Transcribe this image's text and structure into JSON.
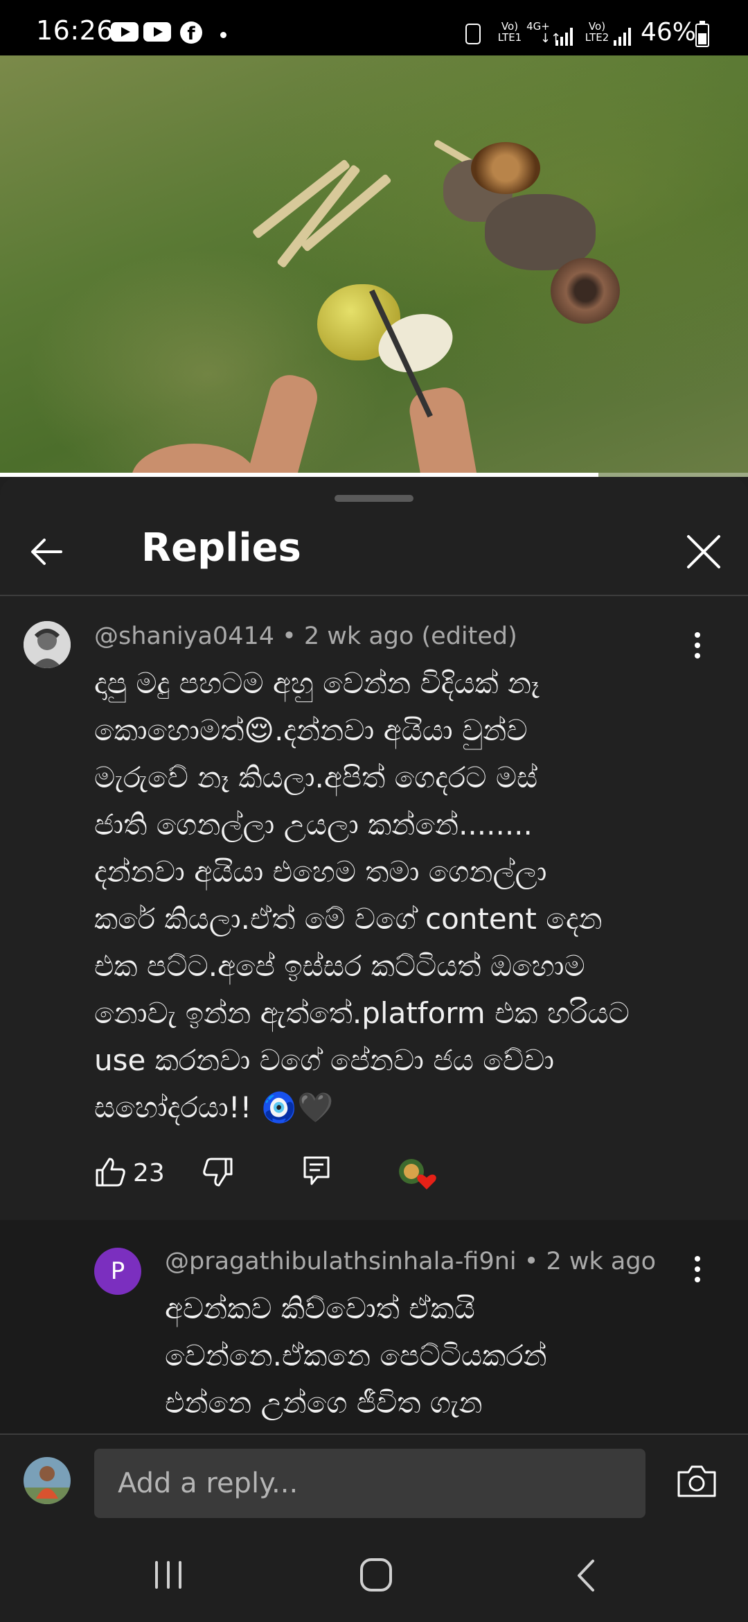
{
  "status_bar": {
    "time": "16:26",
    "sim1": "Vo)\nLTE1",
    "net": "4G+",
    "sim2": "Vo)\nLTE2",
    "battery": "46%"
  },
  "video": {
    "progress": 0.8
  },
  "header": {
    "title": "Replies"
  },
  "comment": {
    "meta": "@shaniya0414 • 2 wk ago (edited)",
    "text": "දාපු මදු පහටම අහු වෙන්න විදියක් නෑ\nකොහොමත්😌.දන්නවා අයියා වුන්ව\nමැරුවේ නෑ කියලා.අපිත් ගෙදරට මස්\nජාති ගෙනල්ලා උයලා කන්නේ........\nදන්නවා අයියා එහෙම තමා ගෙනල්ලා\nකරේ කියලා.ඒත් මේ වගේ content  දෙන\nඑක පට්ට.අපේ ඉස්සර කට්ටියත් ඔහොම\nනොවැ ඉන්න ඇත්තේ.platform එක හරියට\nuse කරනවා වගේ පේනවා ජය වේවා\nසහෝදරයා!! 🧿🖤",
    "likes": "23"
  },
  "reply": {
    "avatar_letter": "P",
    "meta": "@pragathibulathsinhala-fi9ni • 2 wk ago",
    "text": "අවන්කව  කිව්වොත් ඒකයි\nවෙන්නෙ.ඒකනෙ පෙට්ටියකරන්\nඑන්නෙ උන්ගෙ ජීවිත ගැන"
  },
  "reply_input": {
    "placeholder": "Add a reply..."
  },
  "icons": {
    "back": "arrow-left-icon",
    "close": "close-icon",
    "more": "more-vert-icon",
    "like": "thumbs-up-icon",
    "dislike": "thumbs-down-icon",
    "reply": "reply-icon",
    "creator_heart": "creator-heart-icon",
    "camera": "camera-icon",
    "nav_recents": "recents-icon",
    "nav_home": "home-icon",
    "nav_back": "nav-back-icon"
  },
  "colors": {
    "background": "#212121",
    "reply_background": "#1b1b1b",
    "reply_avatar": "#7b2fbf",
    "heart": "#e62117"
  }
}
